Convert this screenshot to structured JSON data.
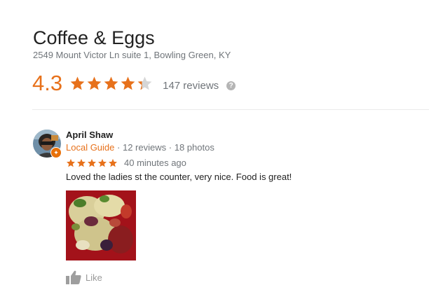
{
  "place": {
    "name": "Coffee & Eggs",
    "address": "2549 Mount Victor Ln suite 1, Bowling Green, KY",
    "rating": "4.3",
    "rating_value": 4.3,
    "review_count": "147 reviews",
    "help_symbol": "?"
  },
  "review": {
    "reviewer_name": "April Shaw",
    "local_guide_label": "Local Guide",
    "separator": "·",
    "reviewer_reviews": "12 reviews",
    "reviewer_photos": "18 photos",
    "stars": 5,
    "time": "40 minutes ago",
    "text": "Loved the ladies st the counter, very nice. Food is great!",
    "like_label": "Like"
  },
  "colors": {
    "accent": "#e7711b",
    "star_empty": "#d6d6d6",
    "meta_gray": "#70757a"
  },
  "icons": {
    "help": "help-circle-icon",
    "star": "star-icon",
    "like": "thumbs-up-icon",
    "guide_badge": "local-guide-badge-icon"
  }
}
